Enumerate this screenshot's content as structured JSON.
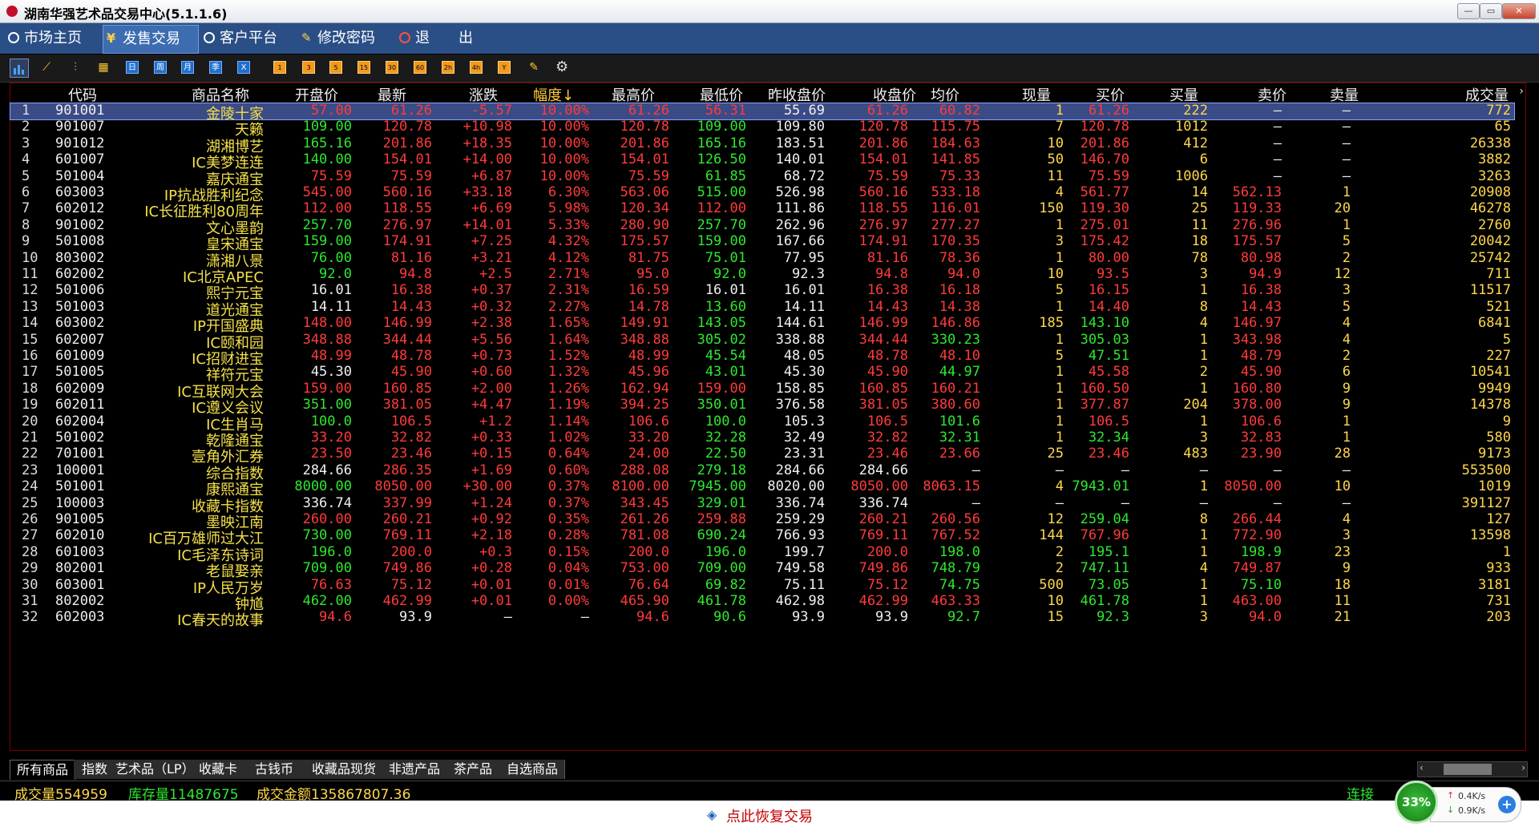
{
  "window": {
    "title": "湖南华强艺术品交易中心(5.1.1.6)"
  },
  "menu": [
    {
      "label": "市场主页",
      "icon": "circle-icon"
    },
    {
      "label": "发售交易",
      "icon": "yen-icon",
      "active": true
    },
    {
      "label": "客户平台",
      "icon": "circle-icon"
    },
    {
      "label": "修改密码",
      "icon": "key-icon"
    },
    {
      "label": "退　　出",
      "icon": "power-icon"
    }
  ],
  "toolbar": {
    "period_labels": [
      "日",
      "周",
      "月",
      "季",
      "X"
    ],
    "number_labels": [
      "1",
      "3",
      "5",
      "15",
      "30",
      "60",
      "2h",
      "4h",
      "Y"
    ]
  },
  "columns": [
    "代码",
    "商品名称",
    "开盘价",
    "最新",
    "涨跌",
    "幅度↓",
    "最高价",
    "最低价",
    "昨收盘价",
    "收盘价",
    "均价",
    "现量",
    "买价",
    "买量",
    "卖价",
    "卖量",
    "成交量"
  ],
  "rows": [
    [
      "1",
      "901001",
      "金陵十家",
      "57.00",
      "61.26",
      "-5.57",
      "10.00%",
      "61.26",
      "56.31",
      "55.69",
      "61.26",
      "60.82",
      "1",
      "61.26",
      "222",
      "—",
      "—",
      "772"
    ],
    [
      "2",
      "901007",
      "天籁",
      "109.00",
      "120.78",
      "+10.98",
      "10.00%",
      "120.78",
      "109.00",
      "109.80",
      "120.78",
      "115.75",
      "7",
      "120.78",
      "1012",
      "—",
      "—",
      "65"
    ],
    [
      "3",
      "901012",
      "湖湘博艺",
      "165.16",
      "201.86",
      "+18.35",
      "10.00%",
      "201.86",
      "165.16",
      "183.51",
      "201.86",
      "184.63",
      "10",
      "201.86",
      "412",
      "—",
      "—",
      "26338"
    ],
    [
      "4",
      "601007",
      "IC美梦连连",
      "140.00",
      "154.01",
      "+14.00",
      "10.00%",
      "154.01",
      "126.50",
      "140.01",
      "154.01",
      "141.85",
      "50",
      "146.70",
      "6",
      "—",
      "—",
      "3882"
    ],
    [
      "5",
      "501004",
      "嘉庆通宝",
      "75.59",
      "75.59",
      "+6.87",
      "10.00%",
      "75.59",
      "61.85",
      "68.72",
      "75.59",
      "75.33",
      "11",
      "75.59",
      "1006",
      "—",
      "—",
      "3263"
    ],
    [
      "6",
      "603003",
      "IP抗战胜利纪念",
      "545.00",
      "560.16",
      "+33.18",
      "6.30%",
      "563.06",
      "515.00",
      "526.98",
      "560.16",
      "533.18",
      "4",
      "561.77",
      "14",
      "562.13",
      "1",
      "20908"
    ],
    [
      "7",
      "602012",
      "IC长征胜利80周年",
      "112.00",
      "118.55",
      "+6.69",
      "5.98%",
      "120.34",
      "112.00",
      "111.86",
      "118.55",
      "116.01",
      "150",
      "119.30",
      "25",
      "119.33",
      "20",
      "46278"
    ],
    [
      "8",
      "901002",
      "文心墨韵",
      "257.70",
      "276.97",
      "+14.01",
      "5.33%",
      "280.90",
      "257.70",
      "262.96",
      "276.97",
      "277.27",
      "1",
      "275.01",
      "11",
      "276.96",
      "1",
      "2760"
    ],
    [
      "9",
      "501008",
      "皇宋通宝",
      "159.00",
      "174.91",
      "+7.25",
      "4.32%",
      "175.57",
      "159.00",
      "167.66",
      "174.91",
      "170.35",
      "3",
      "175.42",
      "18",
      "175.57",
      "5",
      "20042"
    ],
    [
      "10",
      "803002",
      "潇湘八景",
      "76.00",
      "81.16",
      "+3.21",
      "4.12%",
      "81.75",
      "75.01",
      "77.95",
      "81.16",
      "78.36",
      "1",
      "80.00",
      "78",
      "80.98",
      "2",
      "25742"
    ],
    [
      "11",
      "602002",
      "IC北京APEC",
      "92.0",
      "94.8",
      "+2.5",
      "2.71%",
      "95.0",
      "92.0",
      "92.3",
      "94.8",
      "94.0",
      "10",
      "93.5",
      "3",
      "94.9",
      "12",
      "711"
    ],
    [
      "12",
      "501006",
      "熙宁元宝",
      "16.01",
      "16.38",
      "+0.37",
      "2.31%",
      "16.59",
      "16.01",
      "16.01",
      "16.38",
      "16.18",
      "5",
      "16.15",
      "1",
      "16.38",
      "3",
      "11517"
    ],
    [
      "13",
      "501003",
      "道光通宝",
      "14.11",
      "14.43",
      "+0.32",
      "2.27%",
      "14.78",
      "13.60",
      "14.11",
      "14.43",
      "14.38",
      "1",
      "14.40",
      "8",
      "14.43",
      "5",
      "521"
    ],
    [
      "14",
      "603002",
      "IP开国盛典",
      "148.00",
      "146.99",
      "+2.38",
      "1.65%",
      "149.91",
      "143.05",
      "144.61",
      "146.99",
      "146.86",
      "185",
      "143.10",
      "4",
      "146.97",
      "4",
      "6841"
    ],
    [
      "15",
      "602007",
      "IC颐和园",
      "348.88",
      "344.44",
      "+5.56",
      "1.64%",
      "348.88",
      "305.02",
      "338.88",
      "344.44",
      "330.23",
      "1",
      "305.03",
      "1",
      "343.98",
      "4",
      "5"
    ],
    [
      "16",
      "601009",
      "IC招财进宝",
      "48.99",
      "48.78",
      "+0.73",
      "1.52%",
      "48.99",
      "45.54",
      "48.05",
      "48.78",
      "48.10",
      "5",
      "47.51",
      "1",
      "48.79",
      "2",
      "227"
    ],
    [
      "17",
      "501005",
      "祥符元宝",
      "45.30",
      "45.90",
      "+0.60",
      "1.32%",
      "45.96",
      "43.01",
      "45.30",
      "45.90",
      "44.97",
      "1",
      "45.58",
      "2",
      "45.90",
      "6",
      "10541"
    ],
    [
      "18",
      "602009",
      "IC互联网大会",
      "159.00",
      "160.85",
      "+2.00",
      "1.26%",
      "162.94",
      "159.00",
      "158.85",
      "160.85",
      "160.21",
      "1",
      "160.50",
      "1",
      "160.80",
      "9",
      "9949"
    ],
    [
      "19",
      "602011",
      "IC遵义会议",
      "351.00",
      "381.05",
      "+4.47",
      "1.19%",
      "394.25",
      "350.01",
      "376.58",
      "381.05",
      "380.60",
      "1",
      "377.87",
      "204",
      "378.00",
      "9",
      "14378"
    ],
    [
      "20",
      "602004",
      "IC生肖马",
      "100.0",
      "106.5",
      "+1.2",
      "1.14%",
      "106.6",
      "100.0",
      "105.3",
      "106.5",
      "101.6",
      "1",
      "106.5",
      "1",
      "106.6",
      "1",
      "9"
    ],
    [
      "21",
      "501002",
      "乾隆通宝",
      "33.20",
      "32.82",
      "+0.33",
      "1.02%",
      "33.20",
      "32.28",
      "32.49",
      "32.82",
      "32.31",
      "1",
      "32.34",
      "3",
      "32.83",
      "1",
      "580"
    ],
    [
      "22",
      "701001",
      "壹角外汇券",
      "23.50",
      "23.46",
      "+0.15",
      "0.64%",
      "24.00",
      "22.50",
      "23.31",
      "23.46",
      "23.66",
      "25",
      "23.46",
      "483",
      "23.90",
      "28",
      "9173"
    ],
    [
      "23",
      "100001",
      "综合指数",
      "284.66",
      "286.35",
      "+1.69",
      "0.60%",
      "288.08",
      "279.18",
      "284.66",
      "284.66",
      "—",
      "—",
      "—",
      "—",
      "—",
      "—",
      "553500"
    ],
    [
      "24",
      "501001",
      "康熙通宝",
      "8000.00",
      "8050.00",
      "+30.00",
      "0.37%",
      "8100.00",
      "7945.00",
      "8020.00",
      "8050.00",
      "8063.15",
      "4",
      "7943.01",
      "1",
      "8050.00",
      "10",
      "1019"
    ],
    [
      "25",
      "100003",
      "收藏卡指数",
      "336.74",
      "337.99",
      "+1.24",
      "0.37%",
      "343.45",
      "329.01",
      "336.74",
      "336.74",
      "—",
      "—",
      "—",
      "—",
      "—",
      "—",
      "391127"
    ],
    [
      "26",
      "901005",
      "墨映江南",
      "260.00",
      "260.21",
      "+0.92",
      "0.35%",
      "261.26",
      "259.88",
      "259.29",
      "260.21",
      "260.56",
      "12",
      "259.04",
      "8",
      "266.44",
      "4",
      "127"
    ],
    [
      "27",
      "602010",
      "IC百万雄师过大江",
      "730.00",
      "769.11",
      "+2.18",
      "0.28%",
      "781.08",
      "690.24",
      "766.93",
      "769.11",
      "767.52",
      "144",
      "767.96",
      "1",
      "772.90",
      "3",
      "13598"
    ],
    [
      "28",
      "601003",
      "IC毛泽东诗词",
      "196.0",
      "200.0",
      "+0.3",
      "0.15%",
      "200.0",
      "196.0",
      "199.7",
      "200.0",
      "198.0",
      "2",
      "195.1",
      "1",
      "198.9",
      "23",
      "1"
    ],
    [
      "29",
      "802001",
      "老鼠娶亲",
      "709.00",
      "749.86",
      "+0.28",
      "0.04%",
      "753.00",
      "709.00",
      "749.58",
      "749.86",
      "748.79",
      "2",
      "747.11",
      "4",
      "749.87",
      "9",
      "933"
    ],
    [
      "30",
      "603001",
      "IP人民万岁",
      "76.63",
      "75.12",
      "+0.01",
      "0.01%",
      "76.64",
      "69.82",
      "75.11",
      "75.12",
      "74.75",
      "500",
      "73.05",
      "1",
      "75.10",
      "18",
      "3181"
    ],
    [
      "31",
      "802002",
      "钟馗",
      "462.00",
      "462.99",
      "+0.01",
      "0.00%",
      "465.90",
      "461.78",
      "462.98",
      "462.99",
      "463.33",
      "10",
      "461.78",
      "1",
      "463.00",
      "11",
      "731"
    ],
    [
      "32",
      "602003",
      "IC春天的故事",
      "94.6",
      "93.9",
      "—",
      "—",
      "94.6",
      "90.6",
      "93.9",
      "93.9",
      "92.7",
      "15",
      "92.3",
      "3",
      "94.0",
      "21",
      "203"
    ]
  ],
  "tabs": [
    "所有商品",
    "指数",
    "艺术品（LP）",
    "收藏卡",
    "古钱币",
    "收藏品现货",
    "非遗产品",
    "茶产品",
    "自选商品"
  ],
  "status": {
    "volume": "成交量554959",
    "stock": "库存量11487675",
    "amount": "成交金额135867807.36",
    "connection": "连接"
  },
  "restore_label": "点此恢复交易",
  "network": {
    "percent": "33%",
    "up": "0.4K/s",
    "down": "0.9K/s"
  },
  "colors": {
    "up": "#ff3b3b",
    "down": "#2ee82e",
    "flat": "#f0f0f0",
    "name": "#f4e04a",
    "menu_bg": "#2a4f86"
  }
}
